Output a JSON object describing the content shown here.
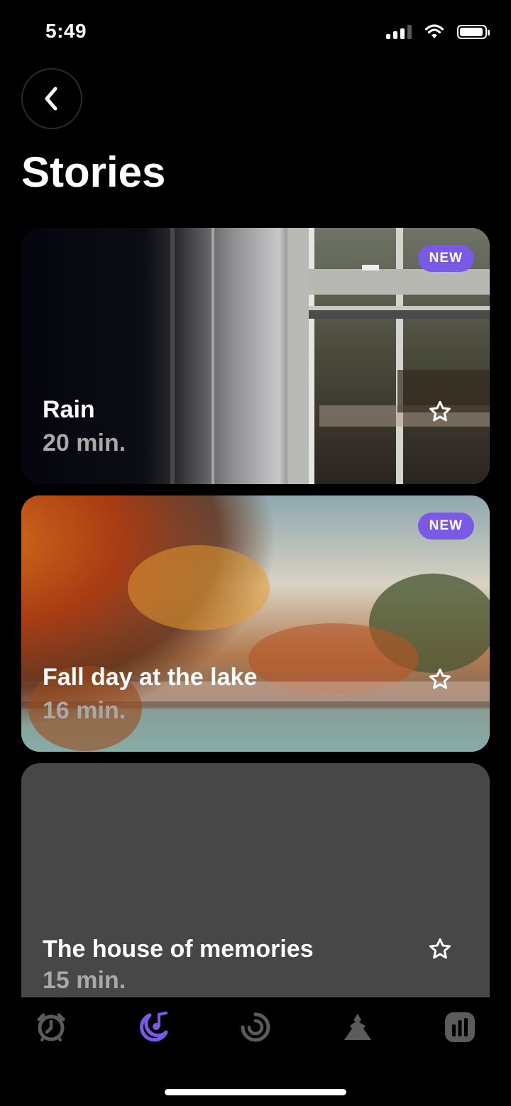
{
  "status_bar": {
    "time": "5:49"
  },
  "page": {
    "title": "Stories"
  },
  "stories": [
    {
      "title": "Rain",
      "duration": "20 min.",
      "badge": "NEW"
    },
    {
      "title": "Fall day at the lake",
      "duration": "16 min.",
      "badge": "NEW"
    },
    {
      "title": "The house of memories",
      "duration": "15 min."
    }
  ],
  "tab_bar": {
    "items": [
      {
        "icon": "alarm-clock-icon",
        "active": false
      },
      {
        "icon": "moon-music-icon",
        "active": true
      },
      {
        "icon": "progress-ring-icon",
        "active": false
      },
      {
        "icon": "mountain-icon",
        "active": false
      },
      {
        "icon": "stats-bars-icon",
        "active": false
      }
    ]
  },
  "colors": {
    "accent": "#7a59e6",
    "inactive_tab": "#5b5b5b",
    "muted_text": "#a8a8a8"
  }
}
